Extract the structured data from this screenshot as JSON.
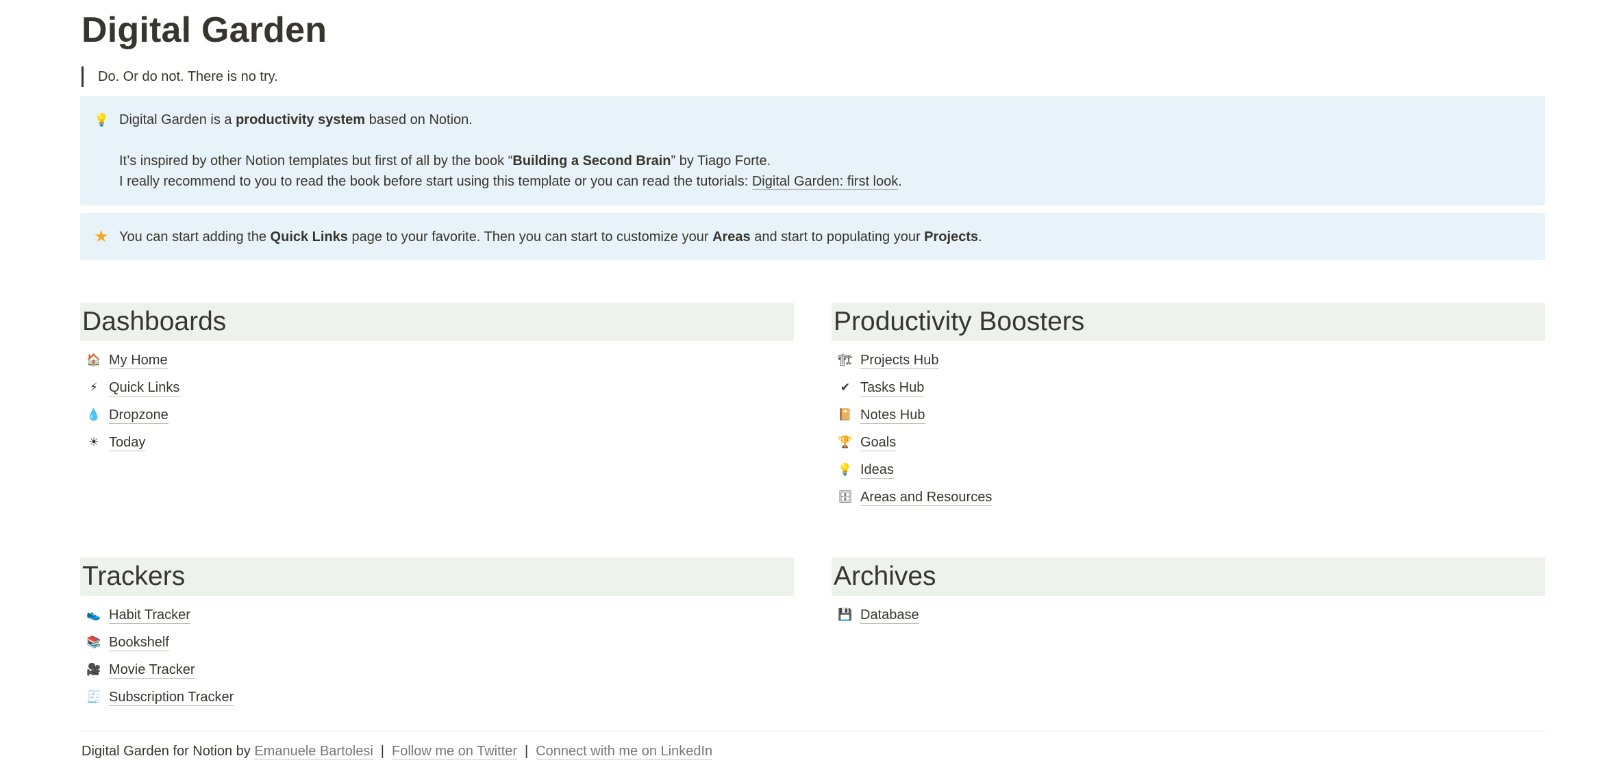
{
  "page": {
    "title": "Digital Garden",
    "quote": "Do. Or do not. There is no try."
  },
  "callout1": {
    "icon": "lightbulb-icon",
    "line1_pre": "Digital Garden is a ",
    "line1_bold": "productivity system",
    "line1_post": " based on Notion.",
    "line2_pre": "It’s inspired by other Notion templates but first of all by the book “",
    "line2_bold": "Building a Second Brain",
    "line2_post": "” by Tiago Forte.",
    "line3_pre": "I really recommend to you to read the book before start using this template or you can read the tutorials: ",
    "line3_link": "Digital Garden: first look",
    "line3_post": "."
  },
  "callout2": {
    "icon": "star-icon",
    "pre": "You can start adding the ",
    "bold1": "Quick Links",
    "mid1": " page to your favorite. Then you can start to customize your ",
    "bold2": "Areas",
    "mid2": " and start to populating your ",
    "bold3": "Projects",
    "post": "."
  },
  "sections": {
    "dashboards": {
      "title": "Dashboards",
      "items": [
        {
          "label": "My Home",
          "icon": "house-icon",
          "glyph": "🏠"
        },
        {
          "label": "Quick Links",
          "icon": "lightning-icon",
          "glyph": "⚡"
        },
        {
          "label": "Dropzone",
          "icon": "droplet-icon",
          "glyph": "💧"
        },
        {
          "label": "Today",
          "icon": "sun-icon",
          "glyph": "☀"
        }
      ]
    },
    "productivity": {
      "title": "Productivity Boosters",
      "items": [
        {
          "label": "Projects Hub",
          "icon": "crane-icon",
          "glyph": "🏗"
        },
        {
          "label": "Tasks Hub",
          "icon": "checkmark-icon",
          "glyph": "✔"
        },
        {
          "label": "Notes Hub",
          "icon": "notebook-icon",
          "glyph": "📔"
        },
        {
          "label": "Goals",
          "icon": "trophy-icon",
          "glyph": "🏆"
        },
        {
          "label": "Ideas",
          "icon": "lightbulb-icon",
          "glyph": "💡"
        },
        {
          "label": "Areas and Resources",
          "icon": "cabinet-icon",
          "glyph": "🗄"
        }
      ]
    },
    "trackers": {
      "title": "Trackers",
      "items": [
        {
          "label": "Habit Tracker",
          "icon": "sneaker-icon",
          "glyph": "👟"
        },
        {
          "label": "Bookshelf",
          "icon": "books-icon",
          "glyph": "📚"
        },
        {
          "label": "Movie Tracker",
          "icon": "movie-camera-icon",
          "glyph": "🎥"
        },
        {
          "label": "Subscription Tracker",
          "icon": "receipt-icon",
          "glyph": "🧾"
        }
      ]
    },
    "archives": {
      "title": "Archives",
      "items": [
        {
          "label": "Database",
          "icon": "floppy-disk-icon",
          "glyph": "💾"
        }
      ]
    }
  },
  "footer": {
    "prefix": "Digital Garden for Notion by ",
    "author": "Emanuele Bartolesi",
    "sep1": "|",
    "twitter": "Follow me on Twitter",
    "sep2": "|",
    "linkedin": "Connect with me on LinkedIn"
  },
  "colors": {
    "callout_bg": "#e7f3f8",
    "section_header_bg": "#edf3ec",
    "text": "#37352f"
  }
}
